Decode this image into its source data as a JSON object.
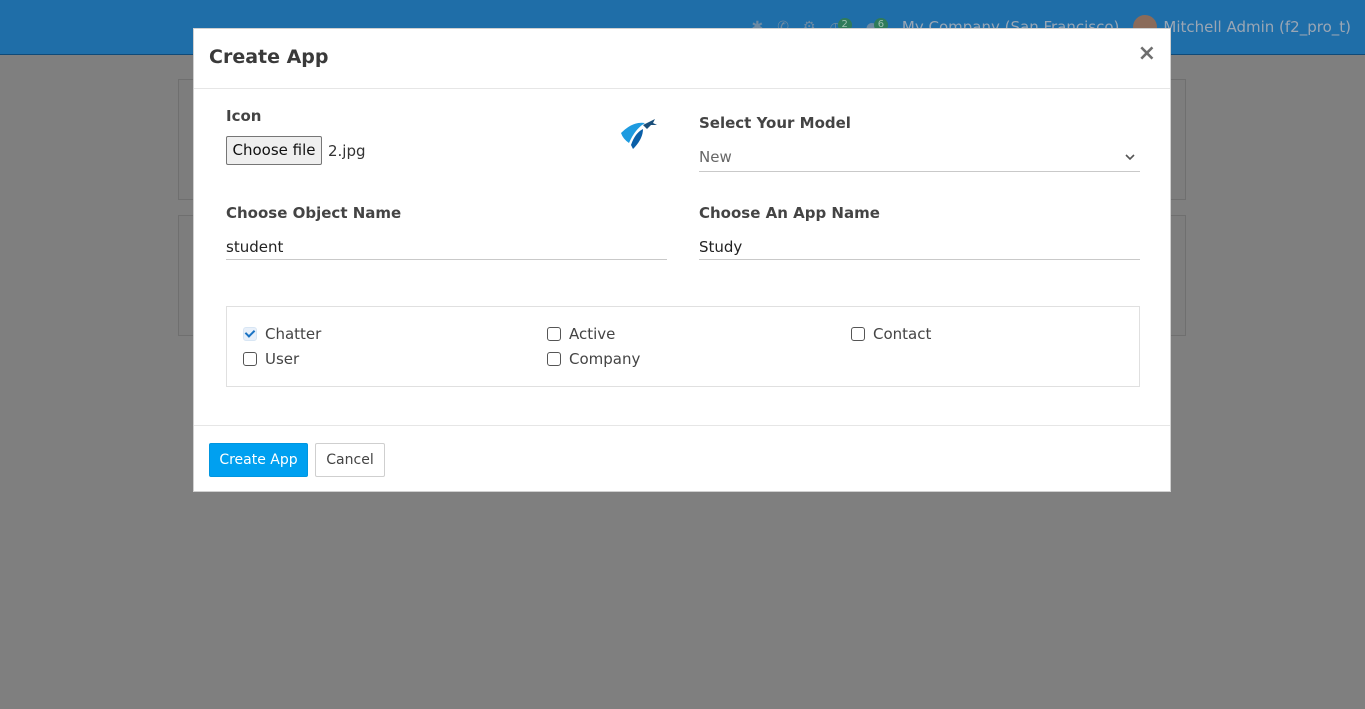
{
  "navbar": {
    "activity_count": "2",
    "messages_count": "6",
    "company": "My Company (San Francisco)",
    "user": "Mitchell Admin (f2_pro_t)",
    "icons": [
      "bug-icon",
      "phone-icon",
      "settings-icon",
      "activity-icon",
      "chat-icon"
    ]
  },
  "modal": {
    "title": "Create App",
    "close_glyph": "×",
    "icon_label": "Icon",
    "file_button_label": "Choose file",
    "file_name": "2.jpg",
    "model_label": "Select Your Model",
    "model_value": "New",
    "object_name_label": "Choose Object Name",
    "object_name_value": "student",
    "app_name_label": "Choose An App Name",
    "app_name_value": "Study",
    "options": [
      {
        "label": "Chatter",
        "checked": true
      },
      {
        "label": "Active",
        "checked": false
      },
      {
        "label": "Contact",
        "checked": false
      },
      {
        "label": "User",
        "checked": false
      },
      {
        "label": "Company",
        "checked": false
      }
    ],
    "create_button_label": "Create App",
    "cancel_button_label": "Cancel"
  },
  "colors": {
    "primary": "#00a0f0",
    "navbar": "#1f6ea8",
    "backdrop": "#7f7f7f"
  }
}
